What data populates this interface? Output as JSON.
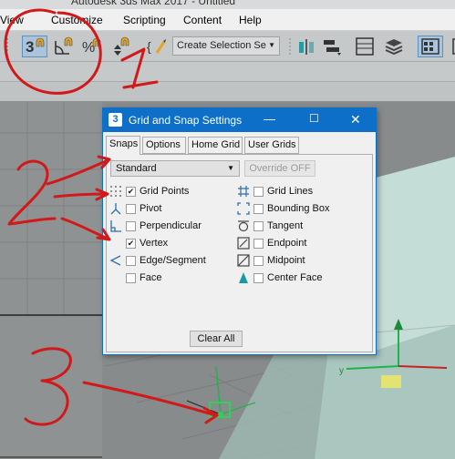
{
  "window": {
    "title_fragment": "Autodesk 3ds Max 2017 - Untitled"
  },
  "menubar": {
    "items": [
      "View",
      "Customize",
      "Scripting",
      "Content",
      "Help"
    ]
  },
  "toolbar": {
    "selection_set_placeholder": "Create Selection Se"
  },
  "dialog": {
    "title": "Grid and Snap Settings",
    "tabs": [
      "Snaps",
      "Options",
      "Home Grid",
      "User Grids"
    ],
    "type_dropdown": "Standard",
    "override_button": "Override OFF",
    "left_snaps": [
      {
        "label": "Grid Points",
        "checked": true,
        "icon": "grid-points-icon"
      },
      {
        "label": "Pivot",
        "checked": false,
        "icon": "pivot-icon"
      },
      {
        "label": "Perpendicular",
        "checked": false,
        "icon": "perpendicular-icon"
      },
      {
        "label": "Vertex",
        "checked": true,
        "icon": "vertex-icon"
      },
      {
        "label": "Edge/Segment",
        "checked": false,
        "icon": "edge-segment-icon"
      },
      {
        "label": "Face",
        "checked": false,
        "icon": "face-icon"
      }
    ],
    "right_snaps": [
      {
        "label": "Grid Lines",
        "checked": false,
        "icon": "grid-lines-icon"
      },
      {
        "label": "Bounding Box",
        "checked": false,
        "icon": "bounding-box-icon"
      },
      {
        "label": "Tangent",
        "checked": false,
        "icon": "tangent-icon"
      },
      {
        "label": "Endpoint",
        "checked": false,
        "icon": "endpoint-icon"
      },
      {
        "label": "Midpoint",
        "checked": false,
        "icon": "midpoint-icon"
      },
      {
        "label": "Center Face",
        "checked": false,
        "icon": "center-face-icon"
      }
    ],
    "clear_all": "Clear All"
  },
  "annotations": {
    "marks": [
      "1",
      "2",
      "3"
    ]
  },
  "colors": {
    "accent": "#0d6fc7",
    "annotation": "#d1191a",
    "box_face": "#c9e3dc"
  }
}
